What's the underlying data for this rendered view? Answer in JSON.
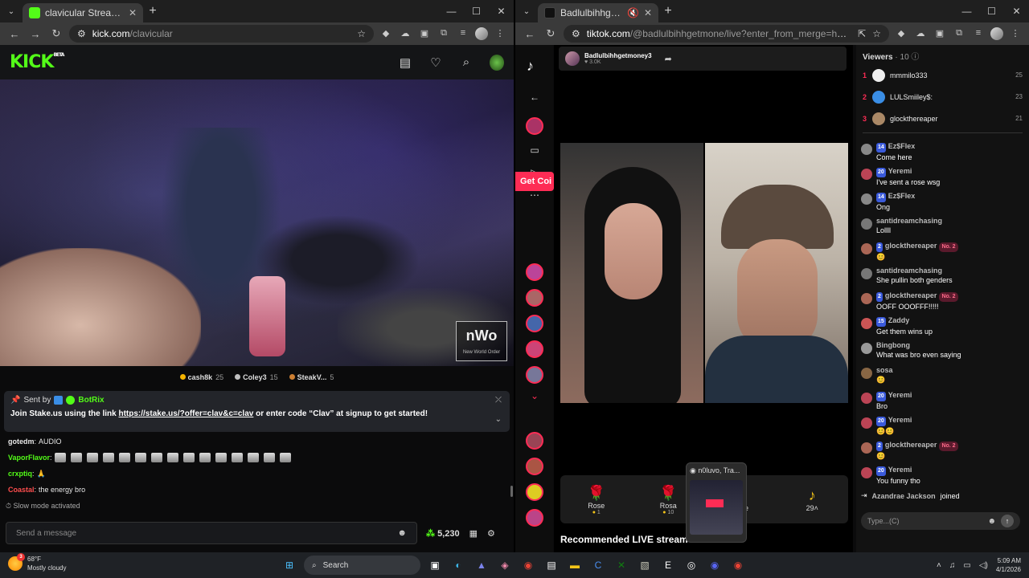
{
  "left": {
    "tab_title": "clavicular Stream - Watch Live o",
    "url_host": "kick.com",
    "url_path": "/clavicular",
    "logo": "KICK",
    "logo_beta": "BETA",
    "gifters": [
      {
        "name": "cash8k",
        "count": "25",
        "color": "#f5b400"
      },
      {
        "name": "Coley3",
        "count": "15",
        "color": "#c0c0c0"
      },
      {
        "name": "SteakV...",
        "count": "5",
        "color": "#cd7f32"
      }
    ],
    "watermark": "nWo",
    "watermark_sub": "New World Order",
    "pinned": {
      "sent_by": "Sent by",
      "bot": "BotRix",
      "msg_pre": "Join Stake.us using the link",
      "msg_link": "https://stake.us/?offer=clav&c=clav",
      "msg_post": "or enter code “Clav” at signup to get started!"
    },
    "chat": [
      {
        "user": "gotedm",
        "text": "AUDIO",
        "color": "#e8e8e8"
      },
      {
        "user": "VaporFlavor",
        "text": "",
        "color": "#53fc18"
      },
      {
        "user": "crxptiq",
        "text": "",
        "color": "#53fc18"
      },
      {
        "user": "Coastal",
        "text": "the energy bro",
        "color": "#ff4e4e"
      }
    ],
    "slow_mode": "Slow mode activated",
    "send_placeholder": "Send a message",
    "points": "5,230"
  },
  "right": {
    "tab_title": "Badlulbihhgetmoney3 (@b",
    "url_host": "tiktok.com",
    "url_path": "/@badlulbihhgetmone/live?enter_from_merge=homepage...",
    "host_name": "Badlulbihhgetmoney3",
    "host_likes": "3.0K",
    "get_coins": "Get Coi",
    "viewers_title": "Viewers",
    "viewers_count": "· 10",
    "top_viewers": [
      {
        "rank": "1",
        "name": "mmmilo333",
        "score": "25"
      },
      {
        "rank": "2",
        "name": "LULSmiiley$:",
        "score": "23"
      },
      {
        "rank": "3",
        "name": "glockthereaper",
        "score": "21"
      }
    ],
    "comments": [
      {
        "user": "Ez$Flex",
        "lv": "14",
        "no2": "",
        "text": "Come here"
      },
      {
        "user": "Yeremi",
        "lv": "20",
        "no2": "",
        "text": "I've sent a rose wsg"
      },
      {
        "user": "Ez$Flex",
        "lv": "14",
        "no2": "",
        "text": "Ong"
      },
      {
        "user": "santidreamchasing",
        "lv": "",
        "no2": "",
        "text": "Lollll"
      },
      {
        "user": "glockthereaper",
        "lv": "2",
        "no2": "No. 2",
        "text": "😊"
      },
      {
        "user": "santidreamchasing",
        "lv": "",
        "no2": "",
        "text": "She pullin both genders"
      },
      {
        "user": "glockthereaper",
        "lv": "2",
        "no2": "No. 2",
        "text": "OOFF OOOFFF!!!!!"
      },
      {
        "user": "Zaddy",
        "lv": "15",
        "no2": "",
        "text": "Get them wins up"
      },
      {
        "user": "Bingbong",
        "lv": "",
        "no2": "",
        "text": "What was bro even saying"
      },
      {
        "user": "sosa",
        "lv": "",
        "no2": "",
        "text": "😊"
      },
      {
        "user": "Yeremi",
        "lv": "20",
        "no2": "",
        "text": "Bro"
      },
      {
        "user": "Yeremi",
        "lv": "20",
        "no2": "",
        "text": "😊😊"
      },
      {
        "user": "glockthereaper",
        "lv": "2",
        "no2": "No. 2",
        "text": "😊"
      },
      {
        "user": "Yeremi",
        "lv": "20",
        "no2": "",
        "text": "You funny tho"
      }
    ],
    "joined_user": "Azandrae Jackson",
    "joined_text": "joined",
    "type_placeholder": "Type...(C)",
    "gifts": [
      {
        "name": "Rose",
        "price": "1",
        "icon": "🌹"
      },
      {
        "name": "Rosa",
        "price": "10",
        "icon": "🌹"
      },
      {
        "name": "More",
        "price": "",
        "icon": "˄"
      },
      {
        "name": "29˄",
        "price": "",
        "icon": "♪"
      }
    ],
    "recommended": "Recommended LIVE stream",
    "thumb_title": "n0luvo, Tra..."
  },
  "taskbar": {
    "temp": "68°F",
    "weather": "Mostly cloudy",
    "weather_badge": "3",
    "search": "Search",
    "time": "5:09 AM",
    "date": "4/1/2026"
  }
}
